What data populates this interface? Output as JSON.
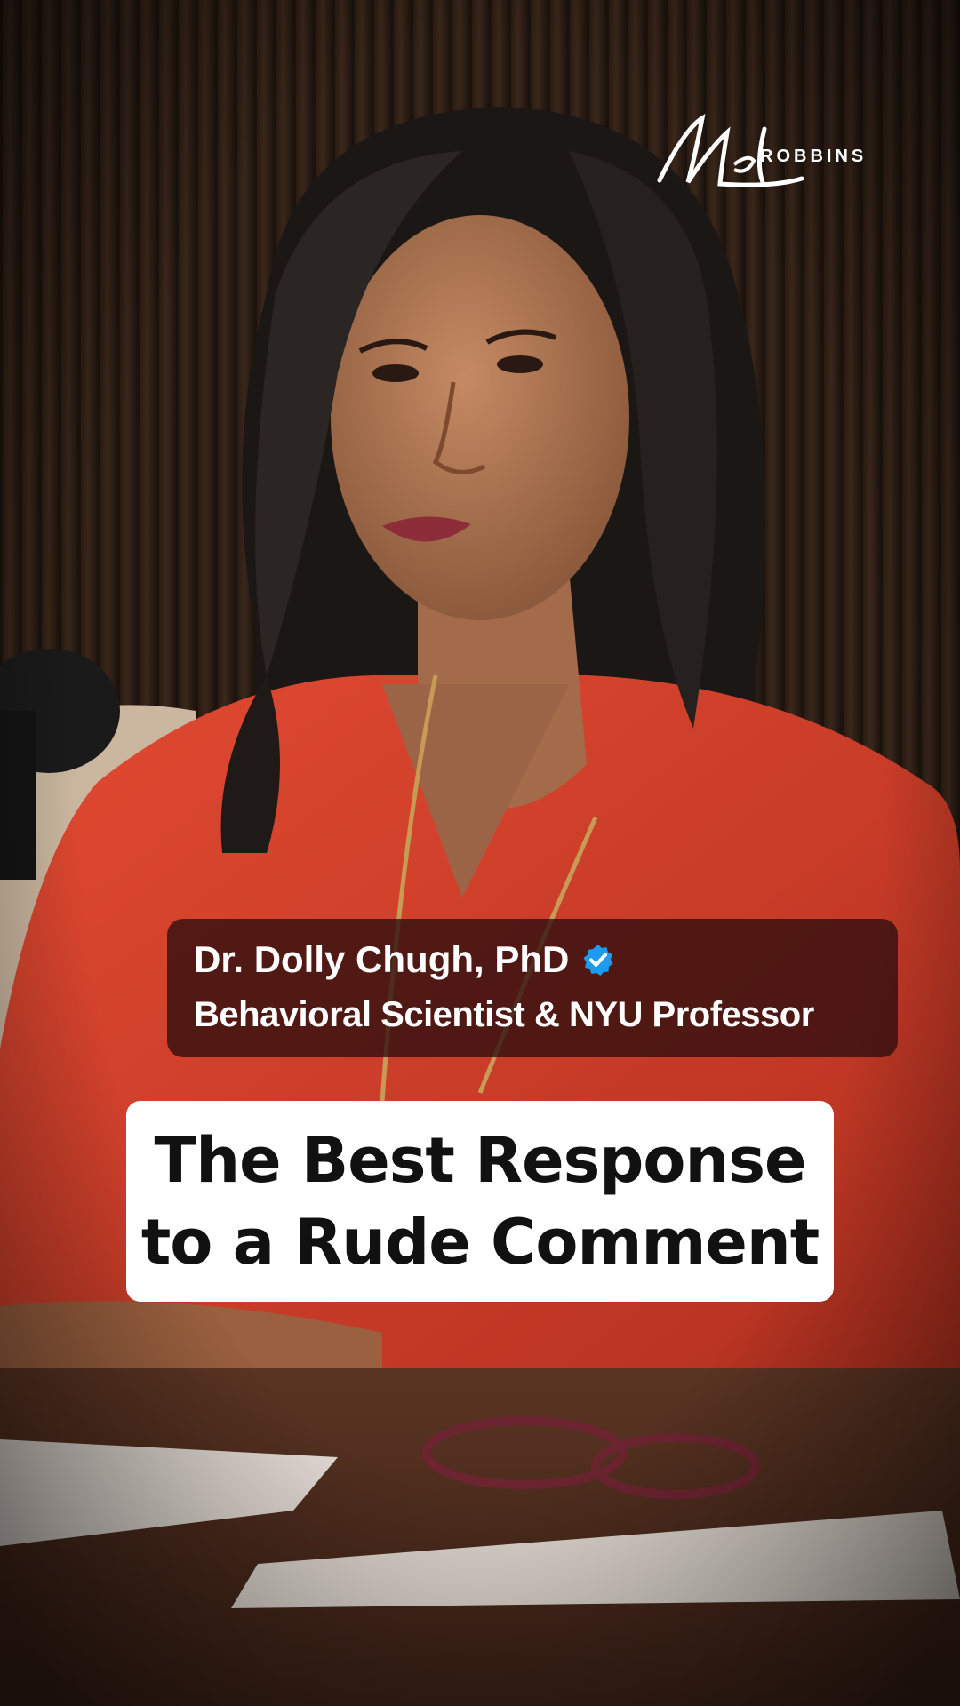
{
  "brand": {
    "script": "Mel",
    "word": "ROBBINS"
  },
  "guest": {
    "name": "Dr. Dolly Chugh, PhD",
    "title": "Behavioral Scientist & NYU Professor",
    "badge_icon": "verified-check-icon",
    "badge_color": "#1d9bf0"
  },
  "headline": {
    "line1": "The Best Response",
    "line2": "to a Rude Comment"
  },
  "colors": {
    "blouse": "#d8402c",
    "background": "#2a1b13",
    "card": "#ffffff"
  }
}
